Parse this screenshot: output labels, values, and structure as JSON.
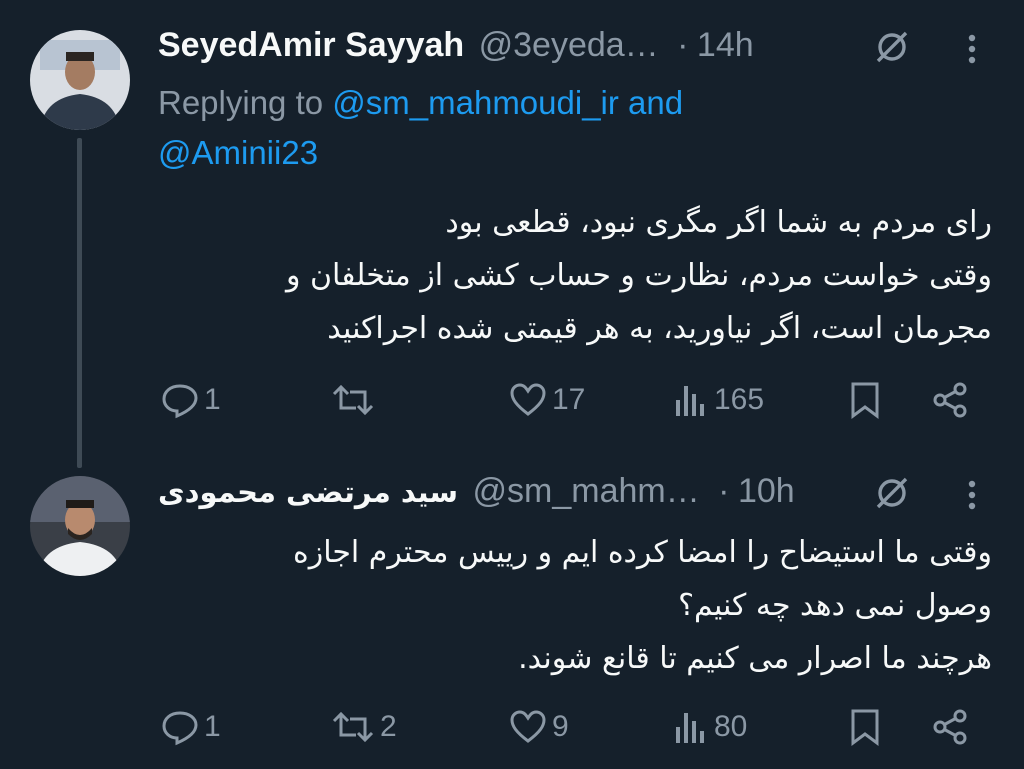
{
  "tweet1": {
    "name": "SeyedAmir Sayyah",
    "handle": "@3eyeda…",
    "dot": "·",
    "time": "14h",
    "replying_prefix": "Replying to",
    "mention1": "@sm_mahmoudi_ir",
    "and": "and",
    "mention2": "@Aminii23",
    "lines": [
      "رای مردم به شما اگر مگری نبود، قطعی بود",
      "وقتی خواست مردم، نظارت و حساب کشی از متخلفان و",
      "مجرمان است، اگر نیاورید، به هر قیمتی شده اجراکنید"
    ],
    "replies": "1",
    "retweets": "",
    "likes": "17",
    "views": "165"
  },
  "tweet2": {
    "name": "سید مرتضی محمودی",
    "handle": "@sm_mahm…",
    "dot": "·",
    "time": "10h",
    "lines": [
      "وقتی ما استیضاح را امضا کرده ایم و رییس محترم اجازه",
      "وصول نمی دهد چه کنیم؟",
      "هرچند ما اصرار می کنیم تا قانع شوند."
    ],
    "replies": "1",
    "retweets": "2",
    "likes": "9",
    "views": "80"
  },
  "colors": {
    "background": "#15202b",
    "text": "#f7f9f9",
    "muted": "#8b98a5",
    "accent": "#1d9bf0"
  }
}
